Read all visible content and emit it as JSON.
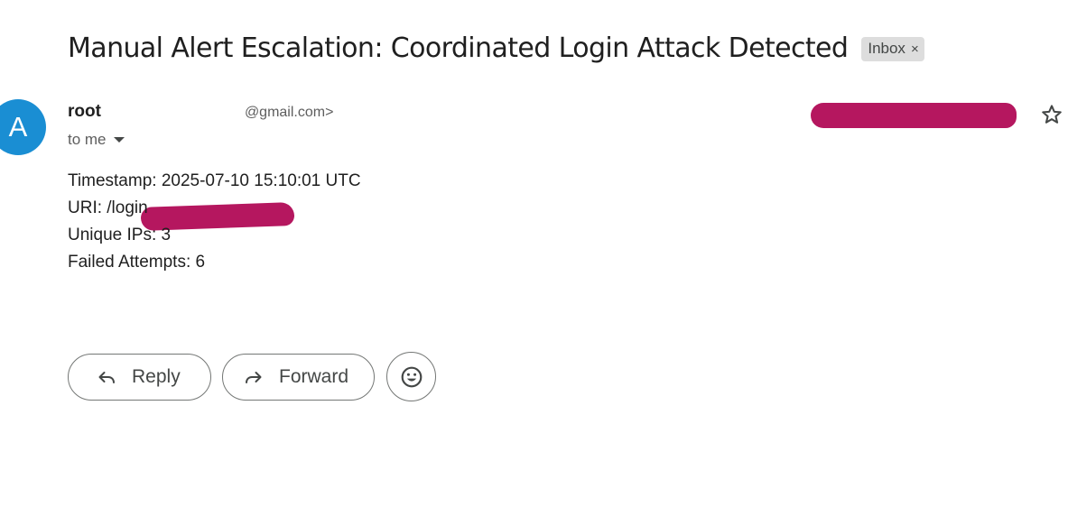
{
  "email": {
    "subject": "Manual Alert Escalation: Coordinated Login Attack Detected",
    "label": "Inbox",
    "label_remove": "×",
    "sender": {
      "avatar_letter": "A",
      "avatar_color": "#1a8ed3",
      "name": "root",
      "email_suffix": "@gmail.com>"
    },
    "recipient": "to me",
    "body": {
      "lines": [
        "Timestamp: 2025-07-10 15:10:01 UTC",
        "URI: /login",
        "Unique IPs: 3",
        "Failed Attempts: 6"
      ]
    }
  },
  "actions": {
    "reply_label": "Reply",
    "forward_label": "Forward"
  },
  "icons": {
    "star": "star-outline-icon",
    "reply": "reply-arrow-icon",
    "forward": "forward-arrow-icon",
    "emoji": "smiley-icon",
    "recipient_details": "caret-down-icon"
  },
  "colors": {
    "redaction": "#b5175f",
    "button_border": "#747775",
    "label_chip": "#dddddd"
  }
}
